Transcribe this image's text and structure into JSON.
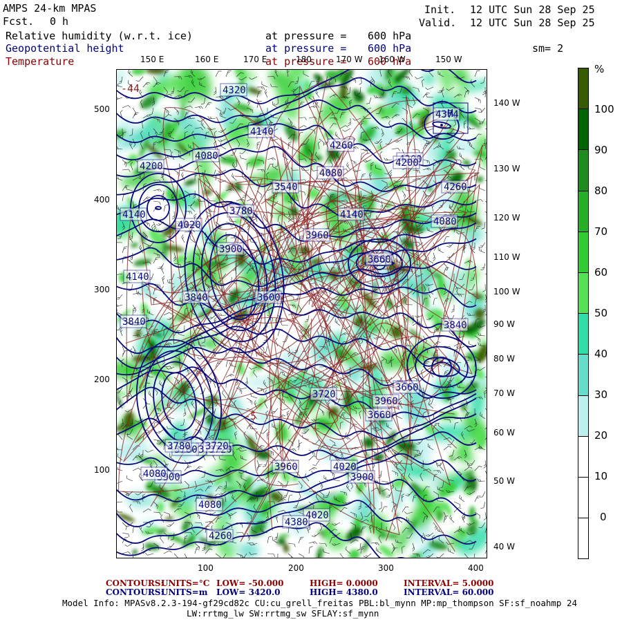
{
  "header": {
    "model_title": "AMPS 24-km MPAS",
    "fcst_label": "Fcst.",
    "fcst_value": "0 h",
    "init_label": "Init.",
    "init_value": "12 UTC Sun 28 Sep 25",
    "valid_label": "Valid.",
    "valid_value": "12 UTC Sun 28 Sep 25",
    "fields": [
      {
        "name": "Relative humidity (w.r.t. ice)",
        "level_text": "at pressure =",
        "level": "600 hPa",
        "color": "#000000"
      },
      {
        "name": "Geopotential height",
        "level_text": "at pressure =",
        "level": "600 hPa",
        "color": "#000080"
      },
      {
        "name": "Temperature",
        "level_text": "at pressure =",
        "level": "600 hPa",
        "color": "#8b0000"
      }
    ],
    "smoothing": "sm= 2"
  },
  "colorbar": {
    "unit": "%",
    "labels": [
      "100",
      "90",
      "80",
      "70",
      "60",
      "50",
      "40",
      "30",
      "20",
      "10",
      "0"
    ],
    "colors": [
      "#3a5a00",
      "#006400",
      "#1e8c1e",
      "#27b027",
      "#33cc33",
      "#55e055",
      "#33ddaa",
      "#66ddcc",
      "#bbf0ee",
      "#ffffff",
      "#ffffff",
      "#ffffff"
    ]
  },
  "map": {
    "top_lon_labels": [
      "150 E",
      "160 E",
      "170 E",
      "180",
      "170 W",
      "160 W",
      "150 W"
    ],
    "right_lon_labels": [
      "140 W",
      "130 W",
      "120 W",
      "110 W",
      "100 W",
      "90 W",
      "80 W",
      "70 W",
      "60 W",
      "50 W",
      "40 W"
    ],
    "left_axis": [
      "500",
      "400",
      "300",
      "200",
      "100"
    ],
    "bottom_axis": [
      "100",
      "200",
      "300",
      "400"
    ],
    "height_labels": [
      "4320",
      "4140",
      "4080",
      "4200",
      "4020",
      "3780",
      "3900",
      "3840",
      "3600",
      "4140",
      "3960",
      "3720",
      "3780",
      "3720",
      "3660",
      "3540",
      "3840",
      "4020",
      "3900",
      "3660",
      "4080",
      "3900",
      "4080",
      "4260",
      "4380",
      "4080",
      "4200",
      "4260",
      "4374",
      "3960",
      "3720",
      "3660",
      "3840",
      "4140",
      "4260",
      "4080",
      "4020",
      "4200",
      "3960",
      "4140",
      "3780",
      "3720"
    ],
    "highs": [
      "H"
    ],
    "temp_labels": [
      "-44",
      "-5"
    ]
  },
  "footer": {
    "temp_contours": {
      "label": "CONTOURS:",
      "units": "UNITS=°C",
      "low": "LOW= -50.000",
      "high": "HIGH= 0.0000",
      "interval": "INTERVAL= 5.0000"
    },
    "hgt_contours": {
      "label": "CONTOURS:",
      "units": "UNITS=m",
      "low": "LOW= 3420.0",
      "high": "HIGH= 4380.0",
      "interval": "INTERVAL= 60.000"
    },
    "model_info_1": "Model Info: MPASv8.2.3-194-gf29cd82c CU:cu_grell_freitas PBL:bl_mynn MP:mp_thompson SF:sf_noahmp 24",
    "model_info_2": "LW:rrtmg_lw SW:rrtmg_sw SFLAY:sf_mynn"
  }
}
